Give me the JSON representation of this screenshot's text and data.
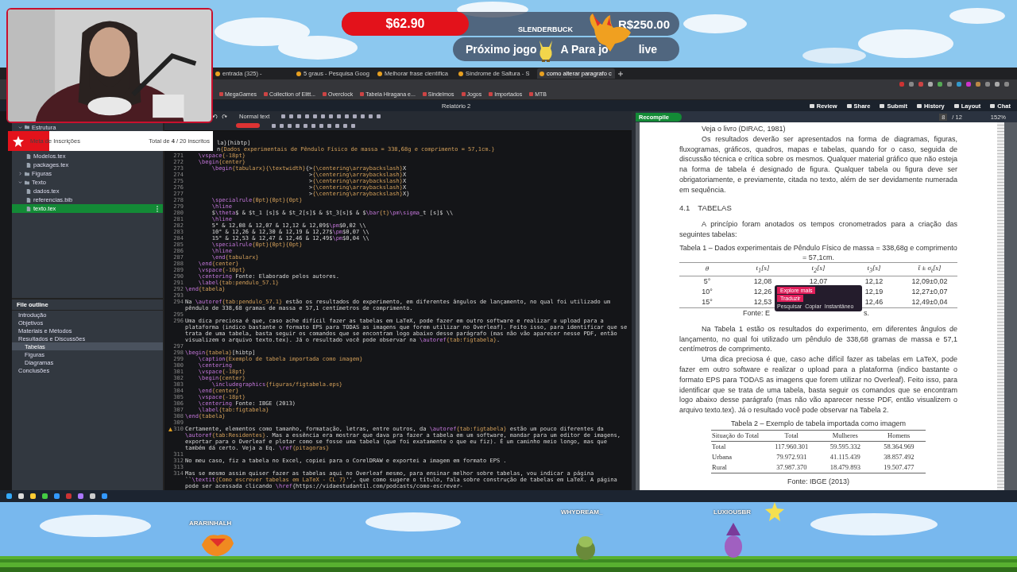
{
  "stream_overlay": {
    "donation_banner": {
      "amount": "$62.90",
      "goal": "R$250.00",
      "username": "SLENDERBUCK",
      "next_label": "Próximo jogo",
      "next_text": "A Para jo",
      "next_suffix": "live"
    },
    "subscriber_goal": {
      "title": "Meta de Inscrições",
      "progress": "Total de **4** / 20 inscritos",
      "level": 0.2
    },
    "viewer_names": [
      "ARARINHALH",
      "WHYDREAM_",
      "LUXIOUSBR"
    ]
  },
  "browser": {
    "tabs": [
      {
        "title": "entrada (325) -",
        "selected": false
      },
      {
        "title": "5 graus - Pesquisa Goog",
        "selected": false
      },
      {
        "title": "Melhorar frase científica",
        "selected": false
      },
      {
        "title": "Síndrome de Saltura - S",
        "selected": false
      },
      {
        "title": "como alterar paragrafo c",
        "selected": true
      }
    ],
    "bookmarks": [
      "MegaGames",
      "Collection of Elitt...",
      "Overclock",
      "Tabela Hiragana e...",
      "Sindelmos",
      "Jogos",
      "Importados",
      "MTB"
    ]
  },
  "overleaf": {
    "project_title": "Relatório 2",
    "header_buttons": [
      "Review",
      "Share",
      "Submit",
      "History",
      "Layout",
      "Chat"
    ],
    "editor_toolbar": {
      "style": "Normal text"
    },
    "file_tree": [
      {
        "name": "Estrutura",
        "kind": "folder",
        "expanded": true,
        "selected": false,
        "children": [
          {
            "name": "Modelos.tex",
            "kind": "file",
            "selected": false
          },
          {
            "name": "packages.tex",
            "kind": "file",
            "selected": false
          }
        ]
      },
      {
        "name": "Figuras",
        "kind": "folder",
        "expanded": false,
        "selected": false
      },
      {
        "name": "Texto",
        "kind": "folder",
        "expanded": true,
        "selected": false,
        "children": [
          {
            "name": "dados.tex",
            "kind": "file",
            "selected": false
          },
          {
            "name": "referencias.bib",
            "kind": "file",
            "selected": false
          },
          {
            "name": "texto.tex",
            "kind": "file",
            "selected": true
          }
        ]
      }
    ],
    "outline": {
      "title": "File outline",
      "items": [
        {
          "label": "Introdução",
          "selected": false
        },
        {
          "label": "Objetivos",
          "selected": false
        },
        {
          "label": "Materiais e Métodos",
          "selected": false
        },
        {
          "label": "Resultados e Discussões",
          "selected": false,
          "children": [
            {
              "label": "Tabelas",
              "selected": true
            },
            {
              "label": "Figuras",
              "selected": false
            },
            {
              "label": "Diagramas",
              "selected": false
            }
          ]
        },
        {
          "label": "Conclusões",
          "selected": false
        }
      ]
    },
    "editor": {
      "lines": [
        {
          "text": "la}[hibtp]"
        },
        {
          "text": "n{Dados experimentais de Pêndulo Físico de massa = 338,68g e comprimento = 57,1cm.}"
        },
        {
          "number": "271",
          "text": "    \\vspace{-18pt}"
        },
        {
          "number": "272",
          "text": "    \\begin{center}"
        },
        {
          "number": "273",
          "text": "        \\begin{tabularx}{\\textwidth}{>{\\centering\\arraybackslash}X"
        },
        {
          "number": "274",
          "text": "                                     >{\\centering\\arraybackslash}X"
        },
        {
          "number": "275",
          "text": "                                     >{\\centering\\arraybackslash}X"
        },
        {
          "number": "276",
          "text": "                                     >{\\centering\\arraybackslash}X"
        },
        {
          "number": "277",
          "text": "                                     >{\\centering\\arraybackslash}X}"
        },
        {
          "number": "278",
          "text": "        \\specialrule{0pt}{0pt}{0pt}"
        },
        {
          "number": "279",
          "text": "        \\hline"
        },
        {
          "number": "280",
          "text": "        $\\theta$ & $t_1 [s]$ & $t_2[s]$ & $t_3[s]$ & $\\bar{t}\\pm\\sigma_t [s]$ \\\\"
        },
        {
          "number": "281",
          "text": "        \\hline"
        },
        {
          "number": "282",
          "text": "        5° & 12,08 & 12,07 & 12,12 & 12,09$\\pm$0,02 \\\\"
        },
        {
          "number": "283",
          "text": "        10° & 12,26 & 12,30 & 12,19 & 12,27$\\pm$0,07 \\\\"
        },
        {
          "number": "284",
          "text": "        15° & 12,53 & 12,47 & 12,46 & 12,49$\\pm$0,04 \\\\"
        },
        {
          "number": "285",
          "text": "        \\specialrule{0pt}{0pt}{0pt}"
        },
        {
          "number": "286",
          "text": "        \\hline"
        },
        {
          "number": "287",
          "text": "        \\end{tabularx}"
        },
        {
          "number": "288",
          "text": "    \\end{center}"
        },
        {
          "number": "289",
          "text": "    \\vspace{-10pt}"
        },
        {
          "number": "290",
          "text": "    \\centering Fonte: Elaborado pelos autores."
        },
        {
          "number": "291",
          "text": "    \\label{tab:pendulo_57.1}"
        },
        {
          "number": "292",
          "text": "\\end{tabela}"
        },
        {
          "number": "293"
        },
        {
          "number": "294",
          "text": "Na \\autoref{tab:pendulo_57.1} estão os resultados do experimento, em diferentes ângulos de lançamento, no qual foi utilizado um pêndulo de 338,68 gramas de massa e 57,1 centímetros de comprimento."
        },
        {
          "number": "295"
        },
        {
          "number": "296",
          "text": "Uma dica preciosa é que, caso ache difícil fazer as tabelas em LaTeX, pode fazer em outro software e realizar o upload para a plataforma (indico bastante o formato EPS para TODAS as imagens que forem utilizar no Overleaf). Feito isso, para identificar que se trata de uma tabela, basta seguir os comandos que se encontram logo abaixo desse parágrafo (mas não vão aparecer nesse PDF, então visualizem o arquivo texto.tex). Já o resultado você pode observar na \\autoref{tab:figtabela}."
        },
        {
          "number": "297"
        },
        {
          "number": "298",
          "text": "\\begin{tabela}[hibtp]"
        },
        {
          "number": "299",
          "text": "    \\caption{Exemplo de tabela importada como imagem}"
        },
        {
          "number": "300",
          "text": "    \\centering"
        },
        {
          "number": "301",
          "text": "    \\vspace{-18pt}"
        },
        {
          "number": "302",
          "text": "    \\begin{center}"
        },
        {
          "number": "303",
          "text": "        \\includegraphics{figuras/figtabela.eps}"
        },
        {
          "number": "304",
          "text": "    \\end{center}"
        },
        {
          "number": "305",
          "text": "    \\vspace{-18pt}"
        },
        {
          "number": "306",
          "text": "    \\centering Fonte: IBGE (2013)"
        },
        {
          "number": "307",
          "text": "    \\label{tab:figtabela}"
        },
        {
          "number": "308",
          "text": "\\end{tabela}"
        },
        {
          "number": "309"
        },
        {
          "number": "310",
          "warning": true,
          "text": "Certamente, elementos como tamanho, formatação, letras, entre outros, da \\autoref{tab:figtabela} estão um pouco diferentes da \\autoref{tab:Residentes}. Mas a essência era mostrar que dava pra fazer a tabela em um software, mandar para um editor de imagens, exportar para o Overleaf e plotar como se fosse uma tabela (que foi exatamente o que eu fiz). É um caminho meio longo, mas que também dá certo. Veja a Eq. \\ref{pitagoras}"
        },
        {
          "number": "311"
        },
        {
          "number": "312",
          "text": "No meu caso, fiz a tabela no Excel, copiei para o CorelDRAW e exportei a imagem em formato EPS ."
        },
        {
          "number": "313"
        },
        {
          "number": "314",
          "text": "Mas se mesmo assim quiser fazer as tabelas aqui no Overleaf mesmo, para ensinar melhor sobre tabelas, vou indicar a página ``\\textit{Como escrever tabelas em LaTeX - CL 7}'', que como sugere o título, fala sobre construção de tabelas em LaTeX. A página pode ser acessada clicando \\href{https://vidaestudantil.com/podcasts/como-escrever-"
        }
      ]
    },
    "pdf": {
      "recompile": "Recompile",
      "page": "8",
      "page_count": "/ 12",
      "zoom": "152%",
      "intro_line": "Veja o livro (DIRAC, 1981)",
      "paragraph_1": "Os resultados deverão ser apresentados na forma de diagramas, figuras, fluxogramas, gráficos, quadros, mapas e tabelas, quando for o caso, seguida de discussão técnica e crítica sobre os mesmos. Qualquer material gráfico que não esteja na forma de tabela é designado de figura. Qualquer tabela ou figura deve ser obrigatoriamente, e previamente, citada no texto, além de ser devidamente numerada em sequência.",
      "section": {
        "number": "4.1",
        "title": "TABELAS"
      },
      "paragraph_2": "A princípio foram anotados os tempos cronometrados para a criação das seguintes tabelas:",
      "table_1": {
        "caption": "Tabela 1 – Dados experimentais de Pêndulo Físico de massa = 338,68g e comprimento = 57,1cm.",
        "columns": [
          "θ",
          "t$_{1}$[s]",
          "t$_{2}$[s]",
          "t$_{3}$[s]",
          "t̄ ± σ$_{t}$[s]"
        ],
        "rows": [
          [
            "5°",
            "12,08",
            "12,07",
            "12,12",
            "12,09±0,02"
          ],
          [
            "10°",
            "12,26",
            null,
            "12,19",
            "12,27±0,07"
          ],
          [
            "15°",
            "12,53",
            null,
            "12,46",
            "12,49±0,04"
          ]
        ],
        "source_parts": [
          "Fonte: E",
          "s."
        ]
      },
      "selection_popup": {
        "buttons": [
          "Explore mais",
          "Traduzir"
        ],
        "actions": [
          "Pesquisar",
          "Copiar",
          "Instantâneo"
        ]
      },
      "paragraph_3": "Na Tabela 1 estão os resultados do experimento, em diferentes ângulos de lançamento, no qual foi utilizado um pêndulo de 338,68 gramas de massa e 57,1 centímetros de comprimento.",
      "paragraph_4": "Uma dica preciosa é que, caso ache difícil fazer as tabelas em LaTeX, pode fazer em outro software e realizar o upload para a plataforma (indico bastante o formato EPS para TODAS as imagens que forem utilizar no Overleaf). Feito isso, para identificar que se trata de uma tabela, basta seguir os comandos que se encontram logo abaixo desse parágrafo (mas não vão aparecer nesse PDF, então visualizem o arquivo texto.tex). Já o resultado você pode observar na Tabela 2.",
      "table_2": {
        "caption": "Tabela 2 – Exemplo de tabela importada como imagem",
        "columns": [
          "Situação do Total",
          "Total",
          "Mulheres",
          "Homens"
        ],
        "rows": [
          [
            "Total",
            "117.960.301",
            "59.595.332",
            "58.364.969"
          ],
          [
            "Urbana",
            "79.972.931",
            "41.115.439",
            "38.857.492"
          ],
          [
            "Rural",
            "37.987.370",
            "18.479.893",
            "19.507.477"
          ]
        ],
        "source": "Fonte: IBGE (2013)"
      }
    }
  }
}
